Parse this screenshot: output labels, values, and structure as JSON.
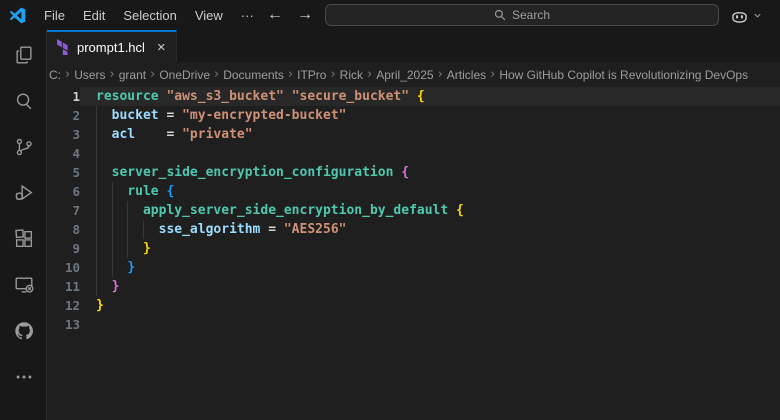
{
  "titlebar": {
    "menus": [
      "File",
      "Edit",
      "Selection",
      "View"
    ],
    "more_menu_label": "···",
    "back_arrow": "←",
    "forward_arrow": "→",
    "search_placeholder": "Search"
  },
  "activity_bar": {
    "items": [
      "explorer",
      "search",
      "source-control",
      "run-debug",
      "extensions",
      "remote-explorer",
      "github",
      "more"
    ]
  },
  "tab": {
    "label": "prompt1.hcl",
    "close_glyph": "×",
    "active_border_color": "#0078d4",
    "terraform_icon_color": "#8a5bd6"
  },
  "breadcrumb": [
    "C:",
    "Users",
    "grant",
    "OneDrive",
    "Documents",
    "ITPro",
    "Rick",
    "April_2025",
    "Articles",
    "How GitHub Copilot is Revolutionizing DevOps"
  ],
  "editor": {
    "colors": {
      "background": "#1f1f1f",
      "current_line": "#282828",
      "line_number": "#6e7681",
      "line_number_active": "#cccccc",
      "indent_guide": "#383838",
      "plain": "#d4d4d4",
      "keyword": "#4ec9b0",
      "string": "#ce9178",
      "property": "#9cdcfe",
      "operator": "#d4d4d4",
      "b1": "#ffd700",
      "b2": "#da70d6",
      "b3": "#179fff"
    },
    "lines": [
      {
        "num": 1,
        "current": true,
        "guides": [],
        "tokens": [
          [
            "resource",
            "keyword"
          ],
          [
            " ",
            "plain"
          ],
          [
            "\"aws_s3_bucket\"",
            "string"
          ],
          [
            " ",
            "plain"
          ],
          [
            "\"secure_bucket\"",
            "string"
          ],
          [
            " ",
            "plain"
          ],
          [
            "{",
            "b1"
          ]
        ]
      },
      {
        "num": 2,
        "guides": [
          0
        ],
        "tokens": [
          [
            "  ",
            "plain"
          ],
          [
            "bucket",
            "property"
          ],
          [
            " ",
            "plain"
          ],
          [
            "=",
            "operator"
          ],
          [
            " ",
            "plain"
          ],
          [
            "\"my-encrypted-bucket\"",
            "string"
          ]
        ]
      },
      {
        "num": 3,
        "guides": [
          0
        ],
        "tokens": [
          [
            "  ",
            "plain"
          ],
          [
            "acl",
            "property"
          ],
          [
            "    ",
            "plain"
          ],
          [
            "=",
            "operator"
          ],
          [
            " ",
            "plain"
          ],
          [
            "\"private\"",
            "string"
          ]
        ]
      },
      {
        "num": 4,
        "guides": [
          0
        ],
        "tokens": []
      },
      {
        "num": 5,
        "guides": [
          0
        ],
        "tokens": [
          [
            "  ",
            "plain"
          ],
          [
            "server_side_encryption_configuration",
            "keyword"
          ],
          [
            " ",
            "plain"
          ],
          [
            "{",
            "b2"
          ]
        ]
      },
      {
        "num": 6,
        "guides": [
          0,
          2
        ],
        "tokens": [
          [
            "    ",
            "plain"
          ],
          [
            "rule",
            "keyword"
          ],
          [
            " ",
            "plain"
          ],
          [
            "{",
            "b3"
          ]
        ]
      },
      {
        "num": 7,
        "guides": [
          0,
          2,
          4
        ],
        "tokens": [
          [
            "      ",
            "plain"
          ],
          [
            "apply_server_side_encryption_by_default",
            "keyword"
          ],
          [
            " ",
            "plain"
          ],
          [
            "{",
            "b1"
          ]
        ]
      },
      {
        "num": 8,
        "guides": [
          0,
          2,
          4,
          6
        ],
        "tokens": [
          [
            "        ",
            "plain"
          ],
          [
            "sse_algorithm",
            "property"
          ],
          [
            " ",
            "plain"
          ],
          [
            "=",
            "operator"
          ],
          [
            " ",
            "plain"
          ],
          [
            "\"AES256\"",
            "string"
          ]
        ]
      },
      {
        "num": 9,
        "guides": [
          0,
          2,
          4
        ],
        "tokens": [
          [
            "      ",
            "plain"
          ],
          [
            "}",
            "b1"
          ]
        ]
      },
      {
        "num": 10,
        "guides": [
          0,
          2
        ],
        "tokens": [
          [
            "    ",
            "plain"
          ],
          [
            "}",
            "b3"
          ]
        ]
      },
      {
        "num": 11,
        "guides": [
          0
        ],
        "tokens": [
          [
            "  ",
            "plain"
          ],
          [
            "}",
            "b2"
          ]
        ]
      },
      {
        "num": 12,
        "guides": [],
        "tokens": [
          [
            "}",
            "b1"
          ]
        ]
      },
      {
        "num": 13,
        "guides": [],
        "tokens": []
      }
    ]
  }
}
